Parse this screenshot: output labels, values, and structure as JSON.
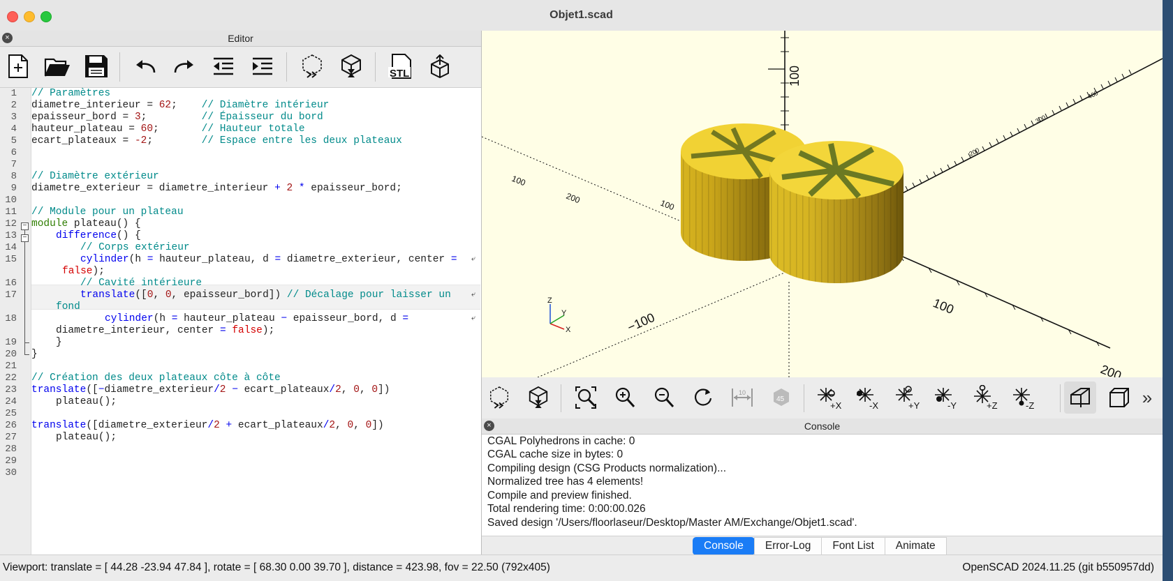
{
  "window": {
    "title": "Objet1.scad"
  },
  "editor": {
    "header": "Editor",
    "close_glyph": "×",
    "toolbar": [
      {
        "name": "new-file-button",
        "icon": "new-file-icon"
      },
      {
        "name": "open-file-button",
        "icon": "folder-open-icon"
      },
      {
        "name": "save-button",
        "icon": "save-icon"
      },
      {
        "name": "undo-button",
        "icon": "undo-icon"
      },
      {
        "name": "redo-button",
        "icon": "redo-icon"
      },
      {
        "name": "unindent-button",
        "icon": "unindent-icon"
      },
      {
        "name": "indent-button",
        "icon": "indent-icon"
      },
      {
        "name": "preview-button",
        "icon": "preview-cube-icon"
      },
      {
        "name": "render-button",
        "icon": "render-cube-icon"
      },
      {
        "name": "export-stl-button",
        "icon": "stl-export-icon",
        "label": "STL"
      },
      {
        "name": "send-to-3d-print-button",
        "icon": "print-cube-icon"
      }
    ],
    "wrap_glyph": "⤶",
    "lines": [
      "1",
      "2",
      "3",
      "4",
      "5",
      "6",
      "7",
      "8",
      "9",
      "10",
      "11",
      "12",
      "13",
      "14",
      "15",
      "16",
      "17",
      "18",
      "19",
      "20",
      "21",
      "22",
      "23",
      "24",
      "25",
      "26",
      "27",
      "28",
      "29",
      "30"
    ]
  },
  "code": {
    "l1_comment": "// Paramètres",
    "l2_a": "diametre_interieur = ",
    "l2_num": "62",
    "l2_b": ";    ",
    "l2_comment": "// Diamètre intérieur",
    "l3_a": "epaisseur_bord = ",
    "l3_num": "3",
    "l3_b": ";         ",
    "l3_comment": "// Épaisseur du bord",
    "l4_a": "hauteur_plateau = ",
    "l4_num": "60",
    "l4_b": ";       ",
    "l4_comment": "// Hauteur totale",
    "l5_a": "ecart_plateaux = ",
    "l5_num": "-2",
    "l5_b": ";        ",
    "l5_comment": "// Espace entre les deux plateaux",
    "l8_comment": "// Diamètre extérieur",
    "l9_a": "diametre_exterieur = diametre_interieur ",
    "l9_plus": "+",
    "l9_sp": " ",
    "l9_num": "2",
    "l9_sp2": " ",
    "l9_star": "*",
    "l9_b": " epaisseur_bord;",
    "l11_comment": "// Module pour un plateau",
    "l12_kw": "module",
    "l12_b": " plateau() {",
    "l13_kw": "difference",
    "l13_b": "() {",
    "l14_comment": "// Corps extérieur",
    "l15_kw": "cylinder",
    "l15_b": "(h ",
    "l15_eq": "=",
    "l15_c": " hauteur_plateau, d ",
    "l15_eq2": "=",
    "l15_d": " diametre_exterieur, center ",
    "l15_eq3": "=",
    "l15w_bool": "false",
    "l15w_b": ");",
    "l16_comment": "// Cavité intérieure",
    "l17_kw": "translate",
    "l17_b": "([",
    "l17_n1": "0",
    "l17_c": ", ",
    "l17_n2": "0",
    "l17_d": ", epaisseur_bord]) ",
    "l17_comment": "// Décalage pour laisser un",
    "l17w_comment": "fond",
    "l18_kw": "cylinder",
    "l18_b": "(h ",
    "l18_eq": "=",
    "l18_c": " hauteur_plateau ",
    "l18_minus": "−",
    "l18_d": " epaisseur_bord, d ",
    "l18_eq2": "=",
    "l18w_a": "diametre_interieur, center ",
    "l18w_eq": "=",
    "l18w_sp": " ",
    "l18w_bool": "false",
    "l18w_b": ");",
    "l19": "}",
    "l20": "}",
    "l22_comment": "// Création des deux plateaux côte à côte",
    "l23_kw": "translate",
    "l23_b": "([",
    "l23_m": "−",
    "l23_c": "diametre_exterieur",
    "l23_div": "/",
    "l23_n": "2",
    "l23_sp": " ",
    "l23_m2": "−",
    "l23_d": " ecart_plateaux",
    "l23_div2": "/",
    "l23_n2": "2",
    "l23_e": ", ",
    "l23_z1": "0",
    "l23_f": ", ",
    "l23_z2": "0",
    "l23_g": "])",
    "l24": "plateau();",
    "l26_kw": "translate",
    "l26_b": "([diametre_exterieur",
    "l26_div": "/",
    "l26_n": "2",
    "l26_sp": " ",
    "l26_plus": "+",
    "l26_d": " ecart_plateaux",
    "l26_div2": "/",
    "l26_n2": "2",
    "l26_e": ", ",
    "l26_z1": "0",
    "l26_f": ", ",
    "l26_z2": "0",
    "l26_g": "])",
    "l27": "plateau();"
  },
  "viewport": {
    "tick_labels": [
      "100",
      "100",
      "200",
      "100",
      "−100",
      "100",
      "200",
      "200",
      "300",
      "400"
    ],
    "axis_letters": {
      "z": "Z",
      "y": "Y",
      "x": "X"
    }
  },
  "view_toolbar": [
    {
      "name": "preview-button",
      "icon": "preview-cube-icon"
    },
    {
      "name": "render-button",
      "icon": "render-cube-icon"
    },
    {
      "name": "view-all-button",
      "icon": "view-all-icon"
    },
    {
      "name": "zoom-in-button",
      "icon": "zoom-in-icon"
    },
    {
      "name": "zoom-out-button",
      "icon": "zoom-out-icon"
    },
    {
      "name": "reset-view-button",
      "icon": "reset-view-icon"
    },
    {
      "name": "show-scale-button",
      "icon": "scale-icon"
    },
    {
      "name": "view-diagonal-button",
      "icon": "diagonal-view-icon"
    },
    {
      "name": "view-right-button",
      "icon": "view-right-icon",
      "label": "+X"
    },
    {
      "name": "view-left-button",
      "icon": "view-left-icon",
      "label": "-X"
    },
    {
      "name": "view-back-button",
      "icon": "view-back-icon",
      "label": "+Y"
    },
    {
      "name": "view-front-button",
      "icon": "view-front-icon",
      "label": "-Y"
    },
    {
      "name": "view-top-button",
      "icon": "view-top-icon",
      "label": "+Z"
    },
    {
      "name": "view-bottom-button",
      "icon": "view-bottom-icon",
      "label": "-Z"
    },
    {
      "name": "perspective-button",
      "icon": "perspective-icon"
    },
    {
      "name": "orthogonal-button",
      "icon": "orthogonal-icon"
    },
    {
      "name": "more-button",
      "icon": "chevron-double-right-icon",
      "label": "»"
    }
  ],
  "console": {
    "header": "Console",
    "lines": [
      "CGAL Polyhedrons in cache: 0",
      "CGAL cache size in bytes: 0",
      "Compiling design (CSG Products normalization)...",
      "Normalized tree has 4 elements!",
      "Compile and preview finished.",
      "Total rendering time: 0:00:00.026",
      "Saved design '/Users/floorlaseur/Desktop/Master AM/Exchange/Objet1.scad'."
    ],
    "tabs": [
      "Console",
      "Error-Log",
      "Font List",
      "Animate"
    ]
  },
  "status": {
    "viewport": "Viewport: translate = [ 44.28 -23.94 47.84 ], rotate = [ 68.30 0.00 39.70 ], distance = 423.98, fov = 22.50 (792x405)",
    "version": "OpenSCAD 2024.11.25 (git b550957dd)"
  },
  "colors": {
    "comment": "#008a8a",
    "number": "#a31515",
    "keyword": "#0000ee",
    "module": "#2e7d00",
    "operator": "#0000ee",
    "bool": "#d40000",
    "model_yellow": "#e8c82a",
    "accent": "#1a7cf6"
  }
}
